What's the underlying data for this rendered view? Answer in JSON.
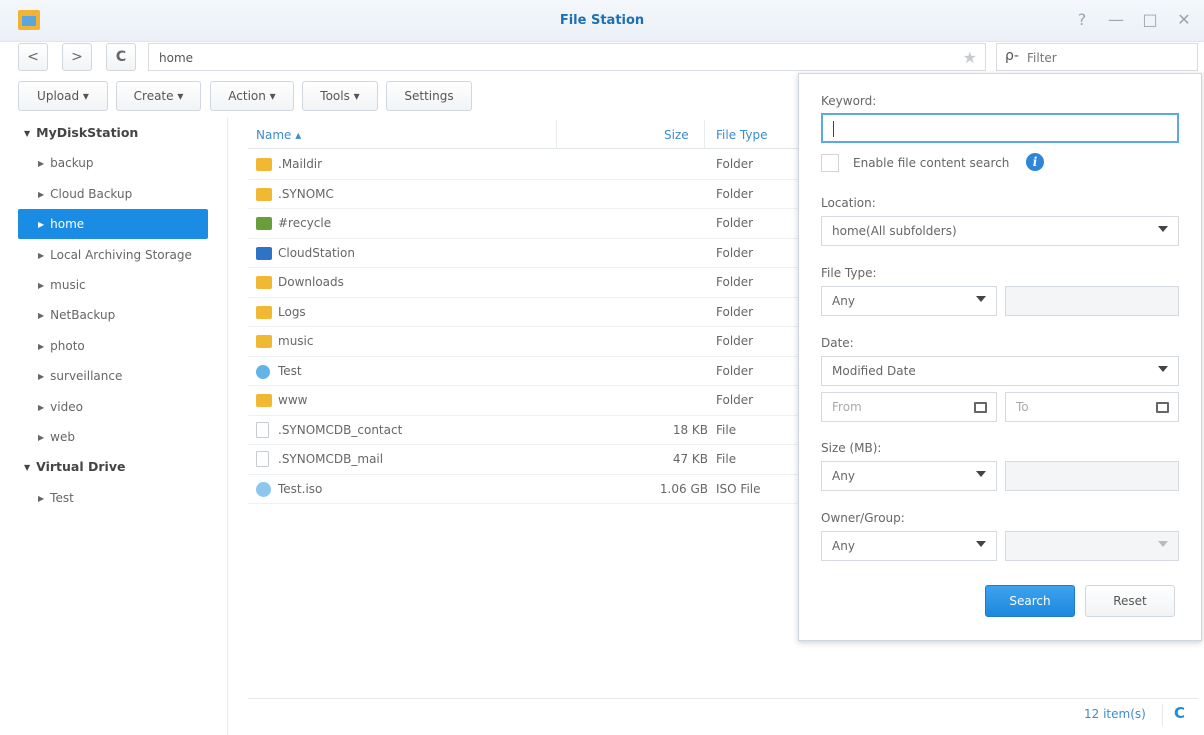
{
  "window": {
    "title": "File Station",
    "help": "?",
    "minimize": "—",
    "maximize": "□",
    "close": "✕"
  },
  "nav": {
    "back": "<",
    "forward": ">",
    "refresh": "C",
    "path": "home",
    "star": "★",
    "filter_placeholder": "Filter",
    "filter_icon": "ρ-"
  },
  "toolbar": {
    "upload": "Upload ▾",
    "create": "Create ▾",
    "action": "Action ▾",
    "tools": "Tools ▾",
    "settings": "Settings"
  },
  "sidebar": {
    "group1": "MyDiskStation",
    "items1": [
      "backup",
      "Cloud Backup",
      "home",
      "Local Archiving Storage",
      "music",
      "NetBackup",
      "photo",
      "surveillance",
      "video",
      "web"
    ],
    "selected": "home",
    "group2": "Virtual Drive",
    "items2": [
      "Test"
    ]
  },
  "file_list": {
    "columns": {
      "name": "Name ▴",
      "size": "Size",
      "type": "File Type"
    },
    "rows": [
      {
        "name": ".Maildir",
        "size": "",
        "type": "Folder",
        "icon": "folder-icon"
      },
      {
        "name": ".SYNOMC",
        "size": "",
        "type": "Folder",
        "icon": "folder-icon"
      },
      {
        "name": "#recycle",
        "size": "",
        "type": "Folder",
        "icon": "recycle-bin-icon"
      },
      {
        "name": "CloudStation",
        "size": "",
        "type": "Folder",
        "icon": "cloud-station-icon"
      },
      {
        "name": "Downloads",
        "size": "",
        "type": "Folder",
        "icon": "folder-icon"
      },
      {
        "name": "Logs",
        "size": "",
        "type": "Folder",
        "icon": "folder-icon"
      },
      {
        "name": "music",
        "size": "",
        "type": "Folder",
        "icon": "folder-icon"
      },
      {
        "name": "Test",
        "size": "",
        "type": "Folder",
        "icon": "shared-folder-icon"
      },
      {
        "name": "www",
        "size": "",
        "type": "Folder",
        "icon": "folder-icon"
      },
      {
        "name": ".SYNOMCDB_contact",
        "size": "18 KB",
        "type": "File",
        "icon": "file-icon"
      },
      {
        "name": ".SYNOMCDB_mail",
        "size": "47 KB",
        "type": "File",
        "icon": "file-icon"
      },
      {
        "name": "Test.iso",
        "size": "1.06 GB",
        "type": "ISO File",
        "icon": "iso-file-icon"
      }
    ],
    "count": "12 item(s)"
  },
  "search_panel": {
    "keyword_label": "Keyword:",
    "keyword_value": "",
    "content_search_label": "Enable file content search",
    "location_label": "Location:",
    "location_value": "home(All subfolders)",
    "filetype_label": "File Type:",
    "filetype_value": "Any",
    "date_label": "Date:",
    "date_value": "Modified Date",
    "from_placeholder": "From",
    "to_placeholder": "To",
    "size_label": "Size (MB):",
    "size_value": "Any",
    "owner_label": "Owner/Group:",
    "owner_value": "Any",
    "search_button": "Search",
    "reset_button": "Reset"
  },
  "colors": {
    "accent": "#1a8ce3",
    "title": "#1f6fb5",
    "folder": "#f1b834"
  }
}
